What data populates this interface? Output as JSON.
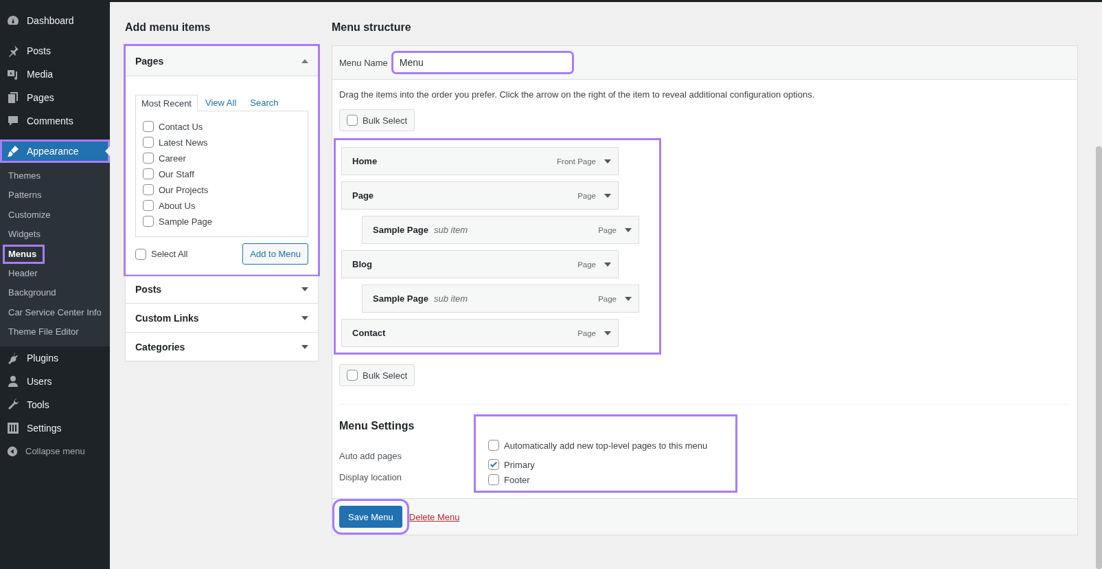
{
  "sidebar": {
    "items": [
      {
        "label": "Dashboard",
        "selected": false,
        "highlighted": false
      },
      {
        "label": "Posts",
        "selected": false,
        "highlighted": false
      },
      {
        "label": "Media",
        "selected": false,
        "highlighted": false
      },
      {
        "label": "Pages",
        "selected": false,
        "highlighted": false
      },
      {
        "label": "Comments",
        "selected": false,
        "highlighted": false
      },
      {
        "label": "Appearance",
        "selected": true,
        "highlighted": true,
        "children": [
          {
            "label": "Themes",
            "selected": false,
            "highlighted": false
          },
          {
            "label": "Patterns",
            "selected": false,
            "highlighted": false
          },
          {
            "label": "Customize",
            "selected": false,
            "highlighted": false
          },
          {
            "label": "Widgets",
            "selected": false,
            "highlighted": false
          },
          {
            "label": "Menus",
            "selected": true,
            "highlighted": true
          },
          {
            "label": "Header",
            "selected": false,
            "highlighted": false
          },
          {
            "label": "Background",
            "selected": false,
            "highlighted": false
          },
          {
            "label": "Car Service Center Info",
            "selected": false,
            "highlighted": false
          },
          {
            "label": "Theme File Editor",
            "selected": false,
            "highlighted": false
          }
        ]
      },
      {
        "label": "Plugins",
        "selected": false,
        "highlighted": false
      },
      {
        "label": "Users",
        "selected": false,
        "highlighted": false
      },
      {
        "label": "Tools",
        "selected": false,
        "highlighted": false
      },
      {
        "label": "Settings",
        "selected": false,
        "highlighted": false
      }
    ],
    "collapse": "Collapse menu"
  },
  "add_menu_items": {
    "title": "Add menu items",
    "panels": [
      {
        "title": "Pages",
        "expanded": true,
        "highlighted": true,
        "tabs": [
          {
            "label": "Most Recent",
            "selected": true
          },
          {
            "label": "View All",
            "selected": false
          },
          {
            "label": "Search",
            "selected": false
          }
        ],
        "pages": [
          {
            "label": "Contact Us",
            "checked": false
          },
          {
            "label": "Latest News",
            "checked": false
          },
          {
            "label": "Career",
            "checked": false
          },
          {
            "label": "Our Staff",
            "checked": false
          },
          {
            "label": "Our Projects",
            "checked": false
          },
          {
            "label": "About Us",
            "checked": false
          },
          {
            "label": "Sample Page",
            "checked": false
          }
        ],
        "select_all": {
          "label": "Select All",
          "checked": false
        },
        "button": "Add to Menu"
      },
      {
        "title": "Posts",
        "expanded": false,
        "highlighted": false
      },
      {
        "title": "Custom Links",
        "expanded": false,
        "highlighted": false
      },
      {
        "title": "Categories",
        "expanded": false,
        "highlighted": false
      }
    ]
  },
  "menu_structure": {
    "title": "Menu structure",
    "menu_name_label": "Menu Name",
    "menu_name": "Menu",
    "menu_name_highlighted": true,
    "instructions": "Drag the items into the order you prefer. Click the arrow on the right of the item to reveal additional configuration options.",
    "bulk_select_top": {
      "label": "Bulk Select",
      "checked": false
    },
    "items_highlighted": true,
    "items": [
      {
        "title": "Home",
        "type": "Front Page"
      },
      {
        "title": "Page",
        "type": "Page",
        "children": [
          {
            "title": "Sample Page",
            "note": "sub item",
            "type": "Page"
          }
        ]
      },
      {
        "title": "Blog",
        "type": "Page",
        "children": [
          {
            "title": "Sample Page",
            "note": "sub item",
            "type": "Page"
          }
        ]
      },
      {
        "title": "Contact",
        "type": "Page"
      }
    ],
    "bulk_select_bottom": {
      "label": "Bulk Select",
      "checked": false
    },
    "settings": {
      "title": "Menu Settings",
      "highlighted": true,
      "rows": [
        {
          "label": "Auto add pages",
          "options": [
            {
              "label": "Automatically add new top-level pages to this menu",
              "checked": false
            }
          ]
        },
        {
          "label": "Display location",
          "options": [
            {
              "label": "Primary",
              "checked": true
            },
            {
              "label": "Footer",
              "checked": false
            }
          ]
        }
      ]
    },
    "save_button": "Save Menu",
    "save_highlighted": true,
    "delete_link": "Delete Menu"
  }
}
